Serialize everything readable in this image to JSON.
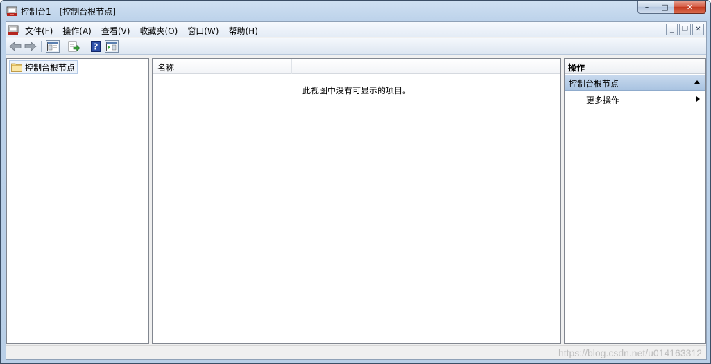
{
  "window": {
    "title": "控制台1 - [控制台根节点]"
  },
  "caption_buttons": {
    "minimize": "–",
    "maximize": "□",
    "close": "✕"
  },
  "menubar": {
    "items": [
      {
        "label": "文件(F)"
      },
      {
        "label": "操作(A)"
      },
      {
        "label": "查看(V)"
      },
      {
        "label": "收藏夹(O)"
      },
      {
        "label": "窗口(W)"
      },
      {
        "label": "帮助(H)"
      }
    ],
    "mdi": {
      "minimize": "_",
      "restore": "❐",
      "close": "✕"
    }
  },
  "toolbar": {
    "icons": [
      "back-arrow-icon",
      "forward-arrow-icon",
      "show-hide-tree-icon",
      "export-list-icon",
      "help-icon",
      "show-hide-action-pane-icon"
    ]
  },
  "tree": {
    "root_label": "控制台根节点"
  },
  "list": {
    "column_name": "名称",
    "empty_message": "此视图中没有可显示的项目。"
  },
  "actions": {
    "title": "操作",
    "section_label": "控制台根节点",
    "more_actions": "更多操作"
  },
  "watermark": "https://blog.csdn.net/u014163312",
  "colors": {
    "title_gradient": "#bcd2ea",
    "selection": "#eef4fb",
    "action_section": "#a9c3e1",
    "close_button": "#c33a20"
  }
}
